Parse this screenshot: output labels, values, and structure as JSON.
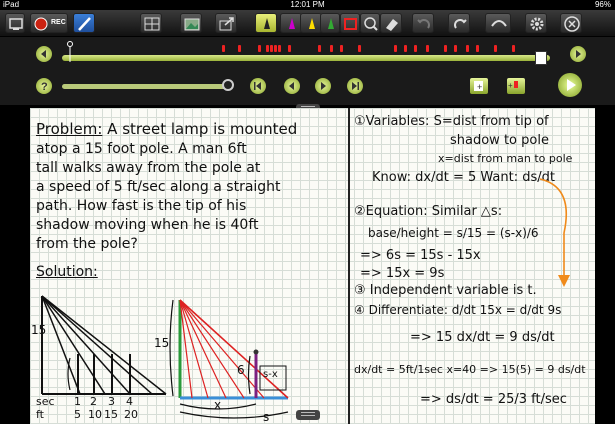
{
  "status": {
    "device": "iPad",
    "time": "12:01 PM",
    "battery": "96%"
  },
  "toolbar": {
    "rec_label": "REC",
    "pen_sizes": [
      "1",
      "3",
      "6",
      "13",
      "19",
      "32"
    ]
  },
  "problem": {
    "heading": "Problem:",
    "lines": [
      "A street lamp is mounted",
      "atop a 15 foot pole. A man 6ft",
      "tall walks away from the pole at",
      "a speed of 5 ft/sec along a straight",
      "path. How fast is the tip of his",
      "shadow moving when he is 40ft",
      "from the pole?"
    ],
    "solution_heading": "Solution:"
  },
  "diagram": {
    "label_15_a": "15",
    "label_15_b": "15",
    "label_6": "6",
    "label_s_minus_x": "s-x",
    "label_x": "x",
    "label_s": "s",
    "row_sec": [
      "sec",
      "1",
      "2",
      "3",
      "4"
    ],
    "row_ft": [
      "ft",
      "5",
      "10",
      "15",
      "20"
    ]
  },
  "notes": {
    "step1": "①Variables: S=dist from tip of",
    "step1b": "shadow to pole",
    "step1c": "x=dist from man to pole",
    "know": "Know: dx/dt = 5   Want: ds/dt",
    "step2": "②Equation: Similar △s:",
    "ratio": "base/height = s/15 = (s-x)/6",
    "eq1": "=> 6s = 15s - 15x",
    "eq2": "=> 15x = 9s",
    "step3": "③ Independent variable is t.",
    "step4": "④ Differentiate: d/dt 15x = d/dt 9s",
    "eq3": "=> 15 dx/dt = 9 ds/dt",
    "given": "dx/dt = 5ft/1sec   x=40 => 15(5) = 9 ds/dt",
    "answer": "=> ds/dt = 25/3 ft/sec"
  }
}
